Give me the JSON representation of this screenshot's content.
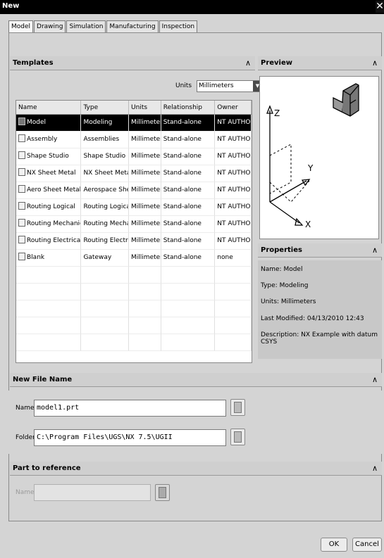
{
  "window": {
    "title": "New",
    "close_glyph": "✕"
  },
  "tabs": [
    "Model",
    "Drawing",
    "Simulation",
    "Manufacturing",
    "Inspection"
  ],
  "templates": {
    "header": "Templates",
    "units_label": "Units",
    "units_value": "Millimeters",
    "columns": [
      "Name",
      "Type",
      "Units",
      "Relationship",
      "Owner"
    ],
    "rows": [
      {
        "name": "Model",
        "type": "Modeling",
        "units": "Millimeters",
        "relationship": "Stand-alone",
        "owner": "NT AUTHO...",
        "selected": true
      },
      {
        "name": "Assembly",
        "type": "Assemblies",
        "units": "Millimeters",
        "relationship": "Stand-alone",
        "owner": "NT AUTHO..."
      },
      {
        "name": "Shape Studio",
        "type": "Shape Studio",
        "units": "Millimeters",
        "relationship": "Stand-alone",
        "owner": "NT AUTHO..."
      },
      {
        "name": "NX Sheet Metal",
        "type": "NX Sheet Metal",
        "units": "Millimeters",
        "relationship": "Stand-alone",
        "owner": "NT AUTHO..."
      },
      {
        "name": "Aero Sheet Metal",
        "type": "Aerospace She...",
        "units": "Millimeters",
        "relationship": "Stand-alone",
        "owner": "NT AUTHO..."
      },
      {
        "name": "Routing Logical",
        "type": "Routing Logical",
        "units": "Millimeters",
        "relationship": "Stand-alone",
        "owner": "NT AUTHO..."
      },
      {
        "name": "Routing Mechanical",
        "type": "Routing Mecha...",
        "units": "Millimeters",
        "relationship": "Stand-alone",
        "owner": "NT AUTHO..."
      },
      {
        "name": "Routing Electrical",
        "type": "Routing Electri...",
        "units": "Millimeters",
        "relationship": "Stand-alone",
        "owner": "NT AUTHO..."
      },
      {
        "name": "Blank",
        "type": "Gateway",
        "units": "Millimeters",
        "relationship": "Stand-alone",
        "owner": "none"
      }
    ]
  },
  "preview": {
    "header": "Preview",
    "axis_z": "Z",
    "axis_y": "Y",
    "axis_x": "X"
  },
  "properties": {
    "header": "Properties",
    "name": "Name: Model",
    "type": "Type: Modeling",
    "units": "Units: Millimeters",
    "last_modified": "Last Modified: 04/13/2010 12:43",
    "description": "Description: NX Example with datum CSYS"
  },
  "new_file": {
    "header": "New File Name",
    "name_label": "Name",
    "name_value": "model1.prt",
    "folder_label": "Folder",
    "folder_value": "C:\\Program Files\\UGS\\NX 7.5\\UGII"
  },
  "part_reference": {
    "header": "Part to reference",
    "name_label": "Name",
    "name_value": ""
  },
  "buttons": {
    "ok": "OK",
    "cancel": "Cancel"
  },
  "chevron": "∧"
}
